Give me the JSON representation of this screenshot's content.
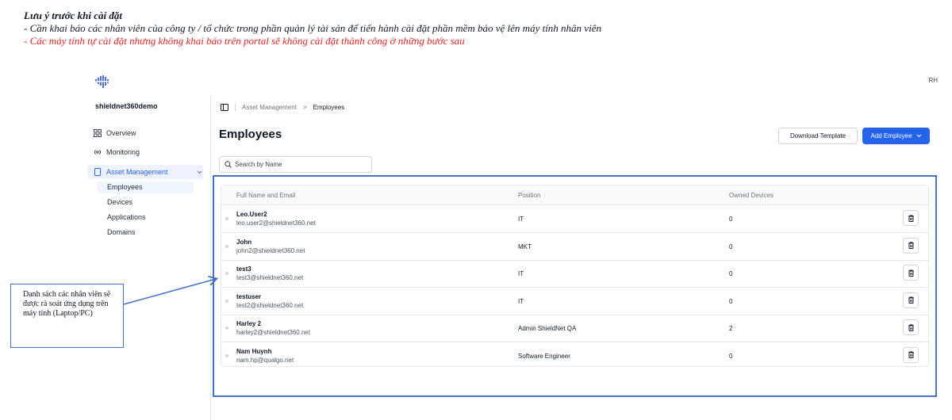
{
  "notes": {
    "title": "Lưu ý trước khi cài đặt",
    "line1": "- Cần khai báo các nhân viên của công ty / tổ chức trong phần quản lý tài sản để tiến hành cài đặt phần mềm bảo vệ lên máy tính nhân viên",
    "line2": "- Các máy tính tự cài đặt nhưng không khai báo trên portal sẽ không cài đặt thành công ở những bước sau"
  },
  "header": {
    "avatar_initials": "RH"
  },
  "sidebar": {
    "org_name": "shieldnet360demo",
    "items": [
      {
        "label": "Overview",
        "icon": "grid-icon"
      },
      {
        "label": "Monitoring",
        "icon": "broadcast-icon"
      },
      {
        "label": "Asset Management",
        "icon": "tablet-icon"
      }
    ],
    "sub_items": [
      "Employees",
      "Devices",
      "Applications",
      "Domains"
    ]
  },
  "breadcrumb": {
    "parent": "Asset Management",
    "separator": ">",
    "current": "Employees"
  },
  "page": {
    "title": "Employees",
    "download_label": "Download Template",
    "add_label": "Add Employee",
    "search_placeholder": "Search by Name"
  },
  "table": {
    "columns": [
      "Full Name and Email",
      "Position",
      "Owned Devices"
    ],
    "rows": [
      {
        "name": "Leo.User2",
        "email": "leo.user2@shieldnet360.net",
        "position": "IT",
        "owned": "0"
      },
      {
        "name": "John",
        "email": "john2@shieldnet360.net",
        "position": "MKT",
        "owned": "0"
      },
      {
        "name": "test3",
        "email": "test3@shieldnet360.net",
        "position": "IT",
        "owned": "0"
      },
      {
        "name": "testuser",
        "email": "test2@shieldnet360.net",
        "position": "IT",
        "owned": "0"
      },
      {
        "name": "Harley 2",
        "email": "harley2@shieldnet360.net",
        "position": "Admin ShieldNet QA",
        "owned": "2"
      },
      {
        "name": "Nam Huynh",
        "email": "nam.hp@qualgo.net",
        "position": "Software Engineer",
        "owned": "0"
      }
    ]
  },
  "callout": {
    "text": "Danh sách các nhân viên sẽ được rà soát ứng dụng trên máy tính (Laptop/PC)"
  },
  "colors": {
    "accent": "#2563eb",
    "annotation_blue": "#4472c4",
    "warning_red": "#e02424"
  }
}
